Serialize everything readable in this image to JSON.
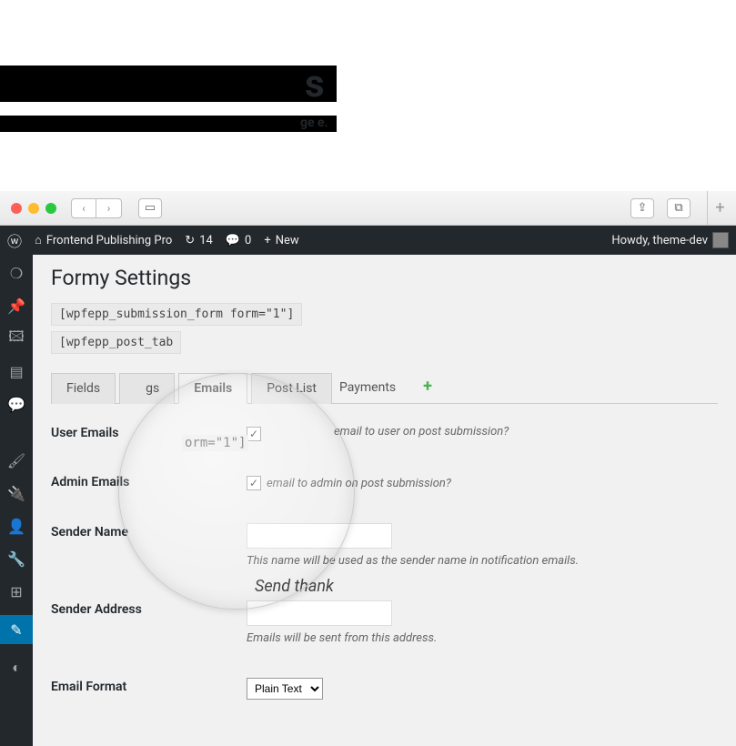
{
  "header_fragment_s": "s",
  "header_fragment_text": "ge                                                                e.",
  "browser": {
    "nav_back": "‹",
    "nav_fwd": "›",
    "share": "⇪",
    "tabs": "⧉",
    "plus": "+"
  },
  "wpbar": {
    "site_name": "Frontend Publishing Pro",
    "updates": "14",
    "comments": "0",
    "new": "New",
    "howdy": "Howdy, theme-dev"
  },
  "page": {
    "title": "Formy Settings",
    "shortcode1": "[wpfepp_submission_form form=\"1\"]",
    "shortcode2": "[wpfepp_post_tab",
    "mag_shortcode_partial": "orm=\"1\"]"
  },
  "tabs": {
    "fields": "Fields",
    "settings_partial": "gs",
    "emails": "Emails",
    "postlist": "Post List",
    "payments_partial": "Payments",
    "plus": "+"
  },
  "form": {
    "user_emails": {
      "label": "User Emails",
      "checked": true,
      "desc_partial": "email to user on post submission?",
      "mag_text": "Send thank"
    },
    "admin_emails": {
      "label": "Admin Emails",
      "checked": true,
      "desc_partial": "email to admin on post submission?"
    },
    "sender_name": {
      "label": "Sender Name",
      "value": "",
      "desc": "This name will be used as the sender name in notification emails."
    },
    "sender_address": {
      "label": "Sender Address",
      "value": "",
      "desc": "Emails will be sent from this address."
    },
    "email_format": {
      "label": "Email Format",
      "value": "Plain Text"
    }
  }
}
